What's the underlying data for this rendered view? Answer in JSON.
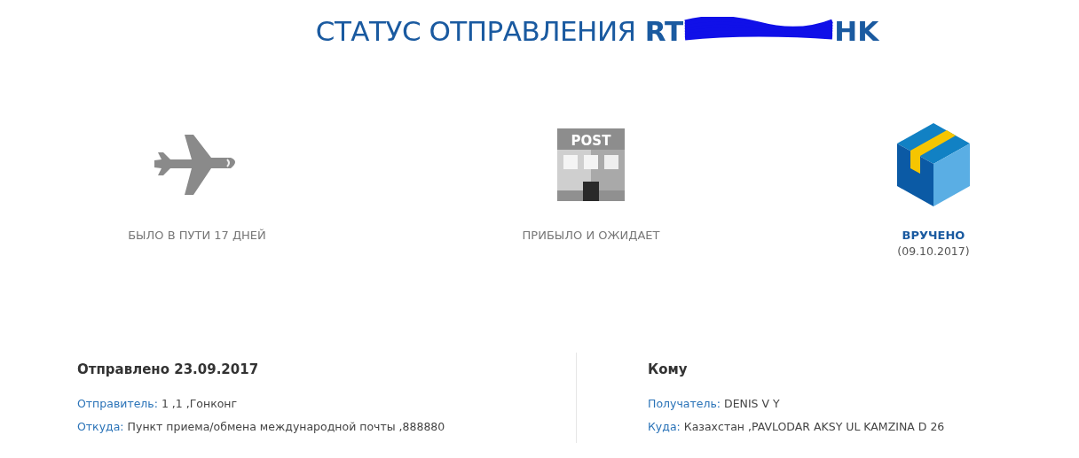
{
  "title": {
    "text": "СТАТУС ОТПРАВЛЕНИЯ",
    "number_start": "RT",
    "number_end": "HK"
  },
  "stages": [
    {
      "kind": "plane",
      "label": "БЫЛО В ПУТИ 17 ДНЕЙ",
      "current": false
    },
    {
      "kind": "post",
      "icon_text": "POST",
      "label": "ПРИБЫЛО И ОЖИДАЕТ",
      "current": false
    },
    {
      "kind": "box",
      "label": "ВРУЧЕНО",
      "date": "(09.10.2017)",
      "current": true
    }
  ],
  "sender": {
    "heading": "Отправлено 23.09.2017",
    "lines": [
      {
        "label": "Отправитель:",
        "value": "1 ,1 ,Гонконг"
      },
      {
        "label": "Откуда:",
        "value": "Пункт приема/обмена международной почты ,888880"
      }
    ]
  },
  "recipient": {
    "heading": "Кому",
    "lines": [
      {
        "label": "Получатель:",
        "value": "DENIS V Y"
      },
      {
        "label": "Куда:",
        "value": "Казахстан ,PAVLODAR AKSY UL KAMZINA D 26"
      }
    ]
  }
}
